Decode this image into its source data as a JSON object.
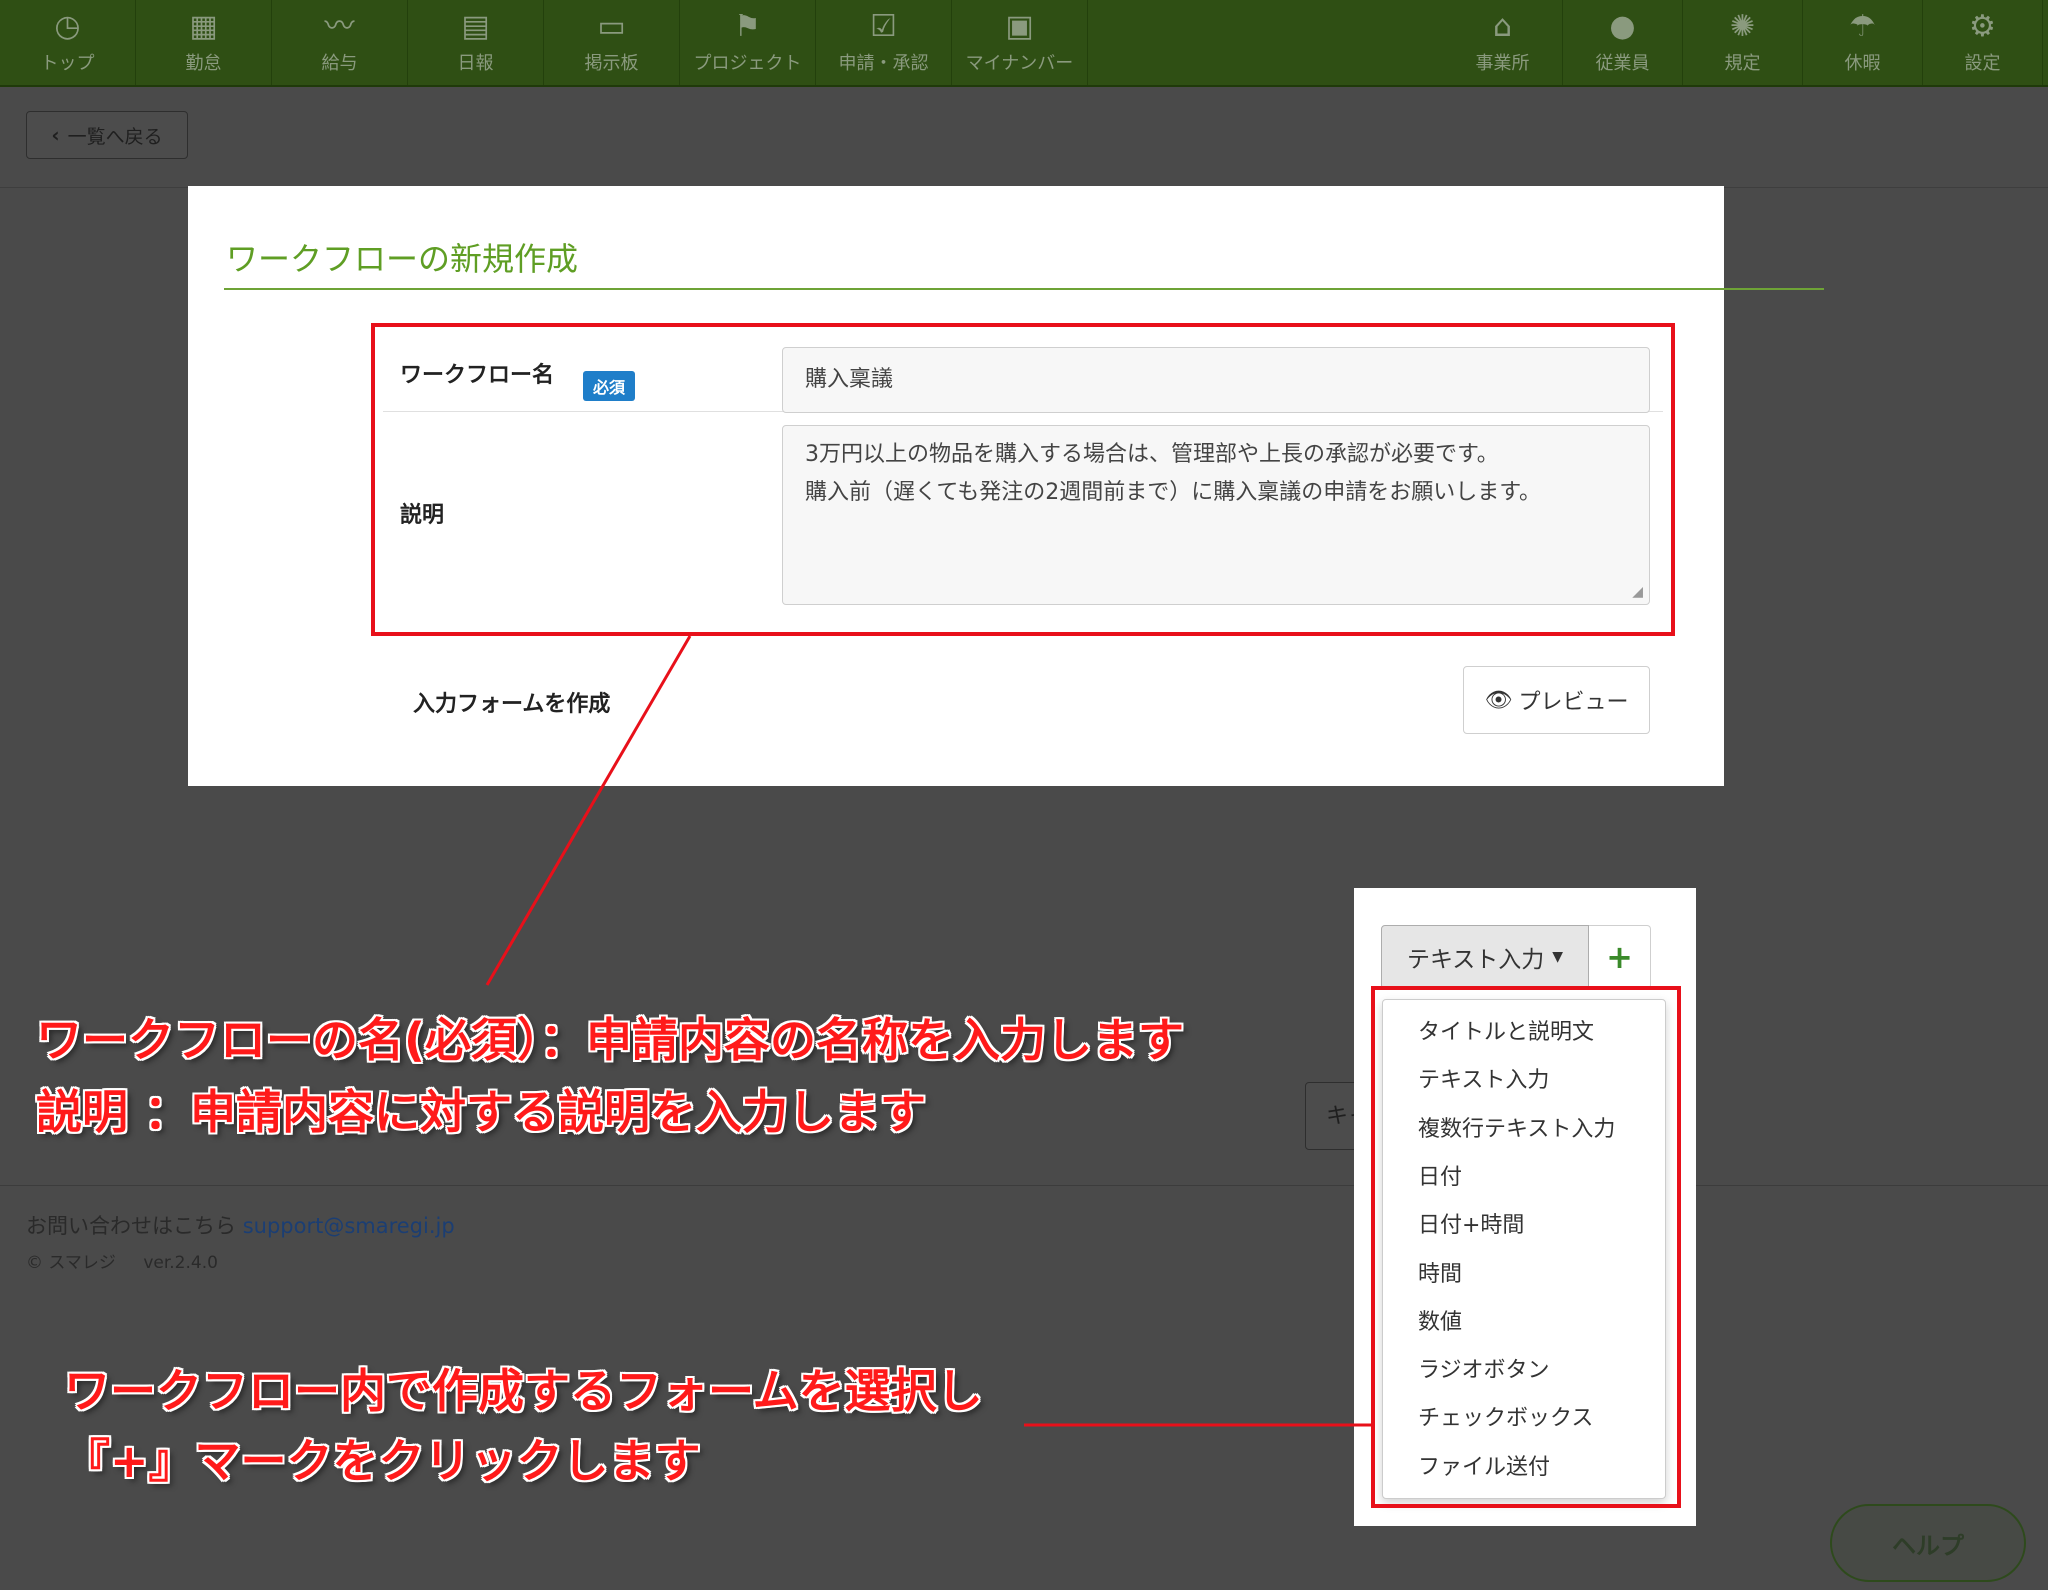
{
  "nav": {
    "left": [
      {
        "label": "トップ",
        "icon": "clock-icon",
        "glyph": "◷"
      },
      {
        "label": "勤怠",
        "icon": "calendar-grid-icon",
        "glyph": "▦"
      },
      {
        "label": "給与",
        "icon": "chart-line-icon",
        "glyph": "〰"
      },
      {
        "label": "日報",
        "icon": "notebook-icon",
        "glyph": "▤"
      },
      {
        "label": "掲示板",
        "icon": "board-icon",
        "glyph": "▭"
      },
      {
        "label": "プロジェクト",
        "icon": "flag-icon",
        "glyph": "⚑"
      },
      {
        "label": "申請・承認",
        "icon": "check-document-icon",
        "glyph": "☑"
      },
      {
        "label": "マイナンバー",
        "icon": "id-card-icon",
        "glyph": "▣"
      }
    ],
    "right": [
      {
        "label": "事業所",
        "icon": "home-icon",
        "glyph": "⌂"
      },
      {
        "label": "従業員",
        "icon": "user-icon",
        "glyph": "●"
      },
      {
        "label": "規定",
        "icon": "alarm-light-icon",
        "glyph": "✺"
      },
      {
        "label": "休暇",
        "icon": "beach-umbrella-icon",
        "glyph": "☂"
      },
      {
        "label": "設定",
        "icon": "gear-icon",
        "glyph": "⚙"
      }
    ]
  },
  "back_button": {
    "label": "一覧へ戻る"
  },
  "card": {
    "title": "ワークフローの新規作成",
    "name_label": "ワークフロー名",
    "required_badge": "必須",
    "name_value": "購入稟議",
    "desc_label": "説明",
    "desc_lines": [
      "3万円以上の物品を購入する場合は、管理部や上長の承認が必要です。",
      "購入前（遅くても発注の2週間前まで）に購入稟議の申請をお願いします。"
    ],
    "form_build_label": "入力フォームを作成",
    "preview_label": "プレビュー"
  },
  "dropdown": {
    "selected": "テキスト入力",
    "add_label": "+",
    "options": [
      "タイトルと説明文",
      "テキスト入力",
      "複数行テキスト入力",
      "日付",
      "日付+時間",
      "時間",
      "数値",
      "ラジオボタン",
      "チェックボックス",
      "ファイル送付"
    ]
  },
  "cancel_label": "キャンセル",
  "footer": {
    "contact_prefix": "お問い合わせはこちら",
    "contact_email": "support@smaregi.jp",
    "copyright": "© スマレジ",
    "version": "ver.2.4.0"
  },
  "help_label": "ヘルプ",
  "annotations": {
    "line1": "ワークフローの名(必須）：申請内容の名称を入力します",
    "line2": "説明 ：申請内容に対する説明を入力します",
    "line3": "ワークフロー内で作成するフォームを選択し",
    "line4": "『+』マークをクリックします"
  },
  "colors": {
    "nav_bg": "#2f4f14",
    "title_green": "#5f9e24",
    "badge_blue": "#1f7ec9",
    "annotation_red": "#e8101a",
    "overlay_gray": "#4a4a4a"
  }
}
